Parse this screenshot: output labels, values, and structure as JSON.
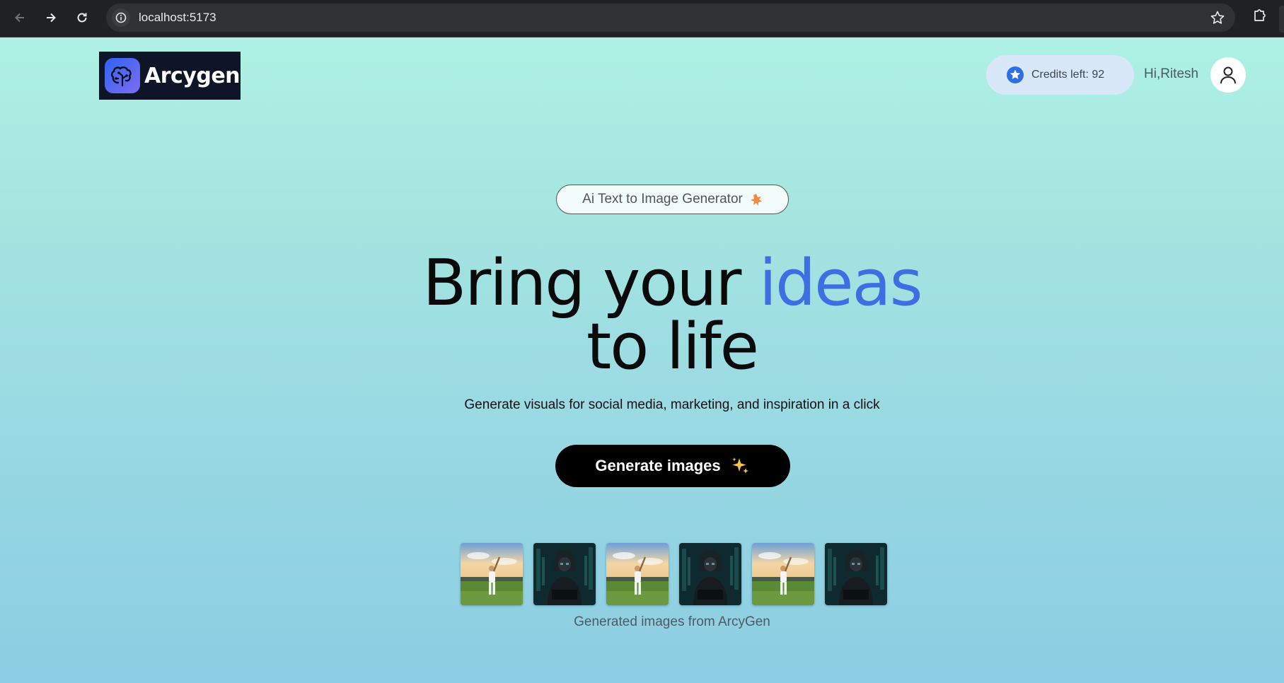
{
  "browser": {
    "url": "localhost:5173"
  },
  "header": {
    "logo_text": "Arcygen",
    "credits_label": "Credits left: 92",
    "greeting": "Hi,Ritesh"
  },
  "hero": {
    "tag": "Ai Text to Image Generator",
    "headline_part1": "Bring your ",
    "headline_accent": "ideas",
    "headline_line2": "to life",
    "subtitle": "Generate visuals for social media, marketing, and inspiration in a click",
    "cta_label": "Generate images",
    "caption": "Generated images from ArcyGen"
  },
  "gallery": {
    "items": [
      "cricket-batsman",
      "dark-hooded-figure",
      "cricket-batsman",
      "dark-hooded-figure",
      "cricket-batsman",
      "dark-hooded-figure"
    ]
  },
  "colors": {
    "accent": "#3d6fe2",
    "cta_bg": "#000000",
    "credits_bg": "#d8e8f8"
  }
}
